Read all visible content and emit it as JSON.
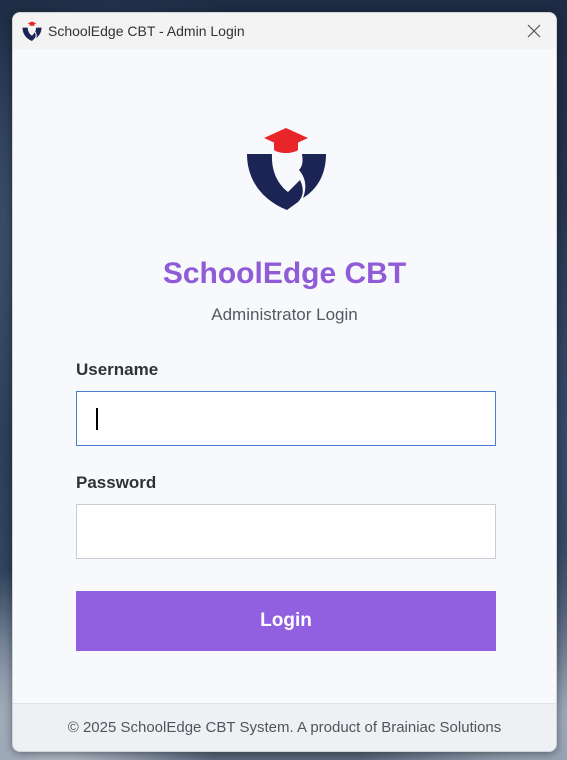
{
  "window": {
    "title": "SchoolEdge CBT - Admin Login",
    "close_icon": "close-icon"
  },
  "brand": {
    "title": "SchoolEdge CBT",
    "subtitle": "Administrator Login",
    "logo_icon": "schooledge-shield-graduation-cap-logo"
  },
  "form": {
    "username_label": "Username",
    "username_value": "",
    "password_label": "Password",
    "password_value": "",
    "login_label": "Login"
  },
  "footer": {
    "text": "© 2025 SchoolEdge CBT System. A product of Brainiac Solutions"
  },
  "colors": {
    "accent": "#9160e0",
    "brand_title": "#8f5bd6",
    "logo_navy": "#1c2456",
    "logo_cap": "#e8262a",
    "focus_border": "#4a7fd0"
  }
}
